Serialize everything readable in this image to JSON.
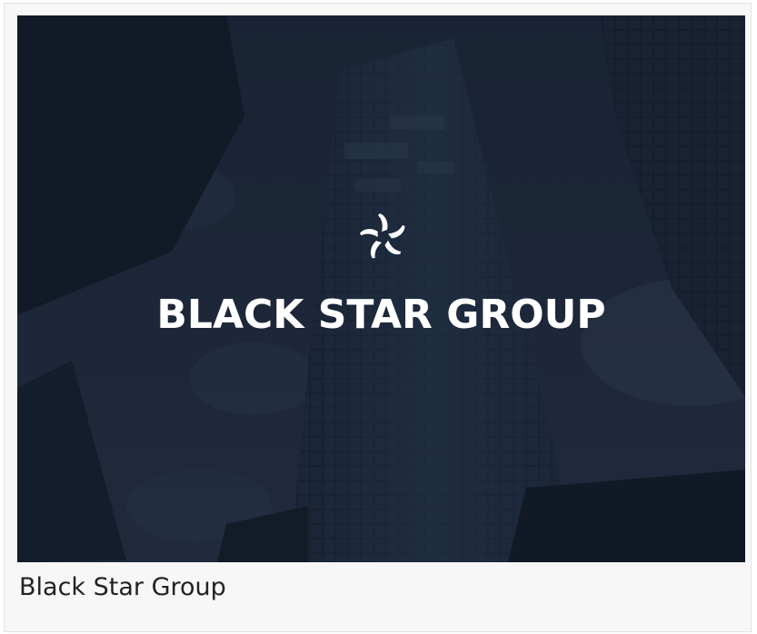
{
  "card": {
    "image_logo_text": "BLACK STAR GROUP",
    "caption": "Black Star Group",
    "logo_icon": "pinwheel-star-icon",
    "colors": {
      "overlay": "#1b2638",
      "logo": "#ffffff",
      "caption_text": "#222222",
      "card_background": "#f7f7f7"
    }
  }
}
